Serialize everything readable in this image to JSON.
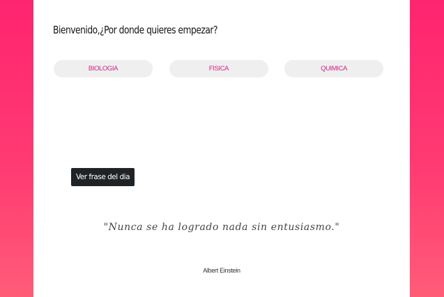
{
  "header": {
    "welcome": "Bienvenido,¿Por donde quieres empezar?"
  },
  "subjects": [
    {
      "label": "BIOLOGIA"
    },
    {
      "label": "FISICA"
    },
    {
      "label": "QUIMICA"
    }
  ],
  "quote_section": {
    "button_label": "Ver frase del dia",
    "quote": "\"Nunca se ha logrado nada sin entusiasmo.\"",
    "author": "Albert Einstein"
  },
  "colors": {
    "background_gradient_top": "#ff2470",
    "background_gradient_bottom": "#ff5c78",
    "subject_text": "#d21e87",
    "subject_bg": "#efefef",
    "button_bg": "#1f2326"
  }
}
